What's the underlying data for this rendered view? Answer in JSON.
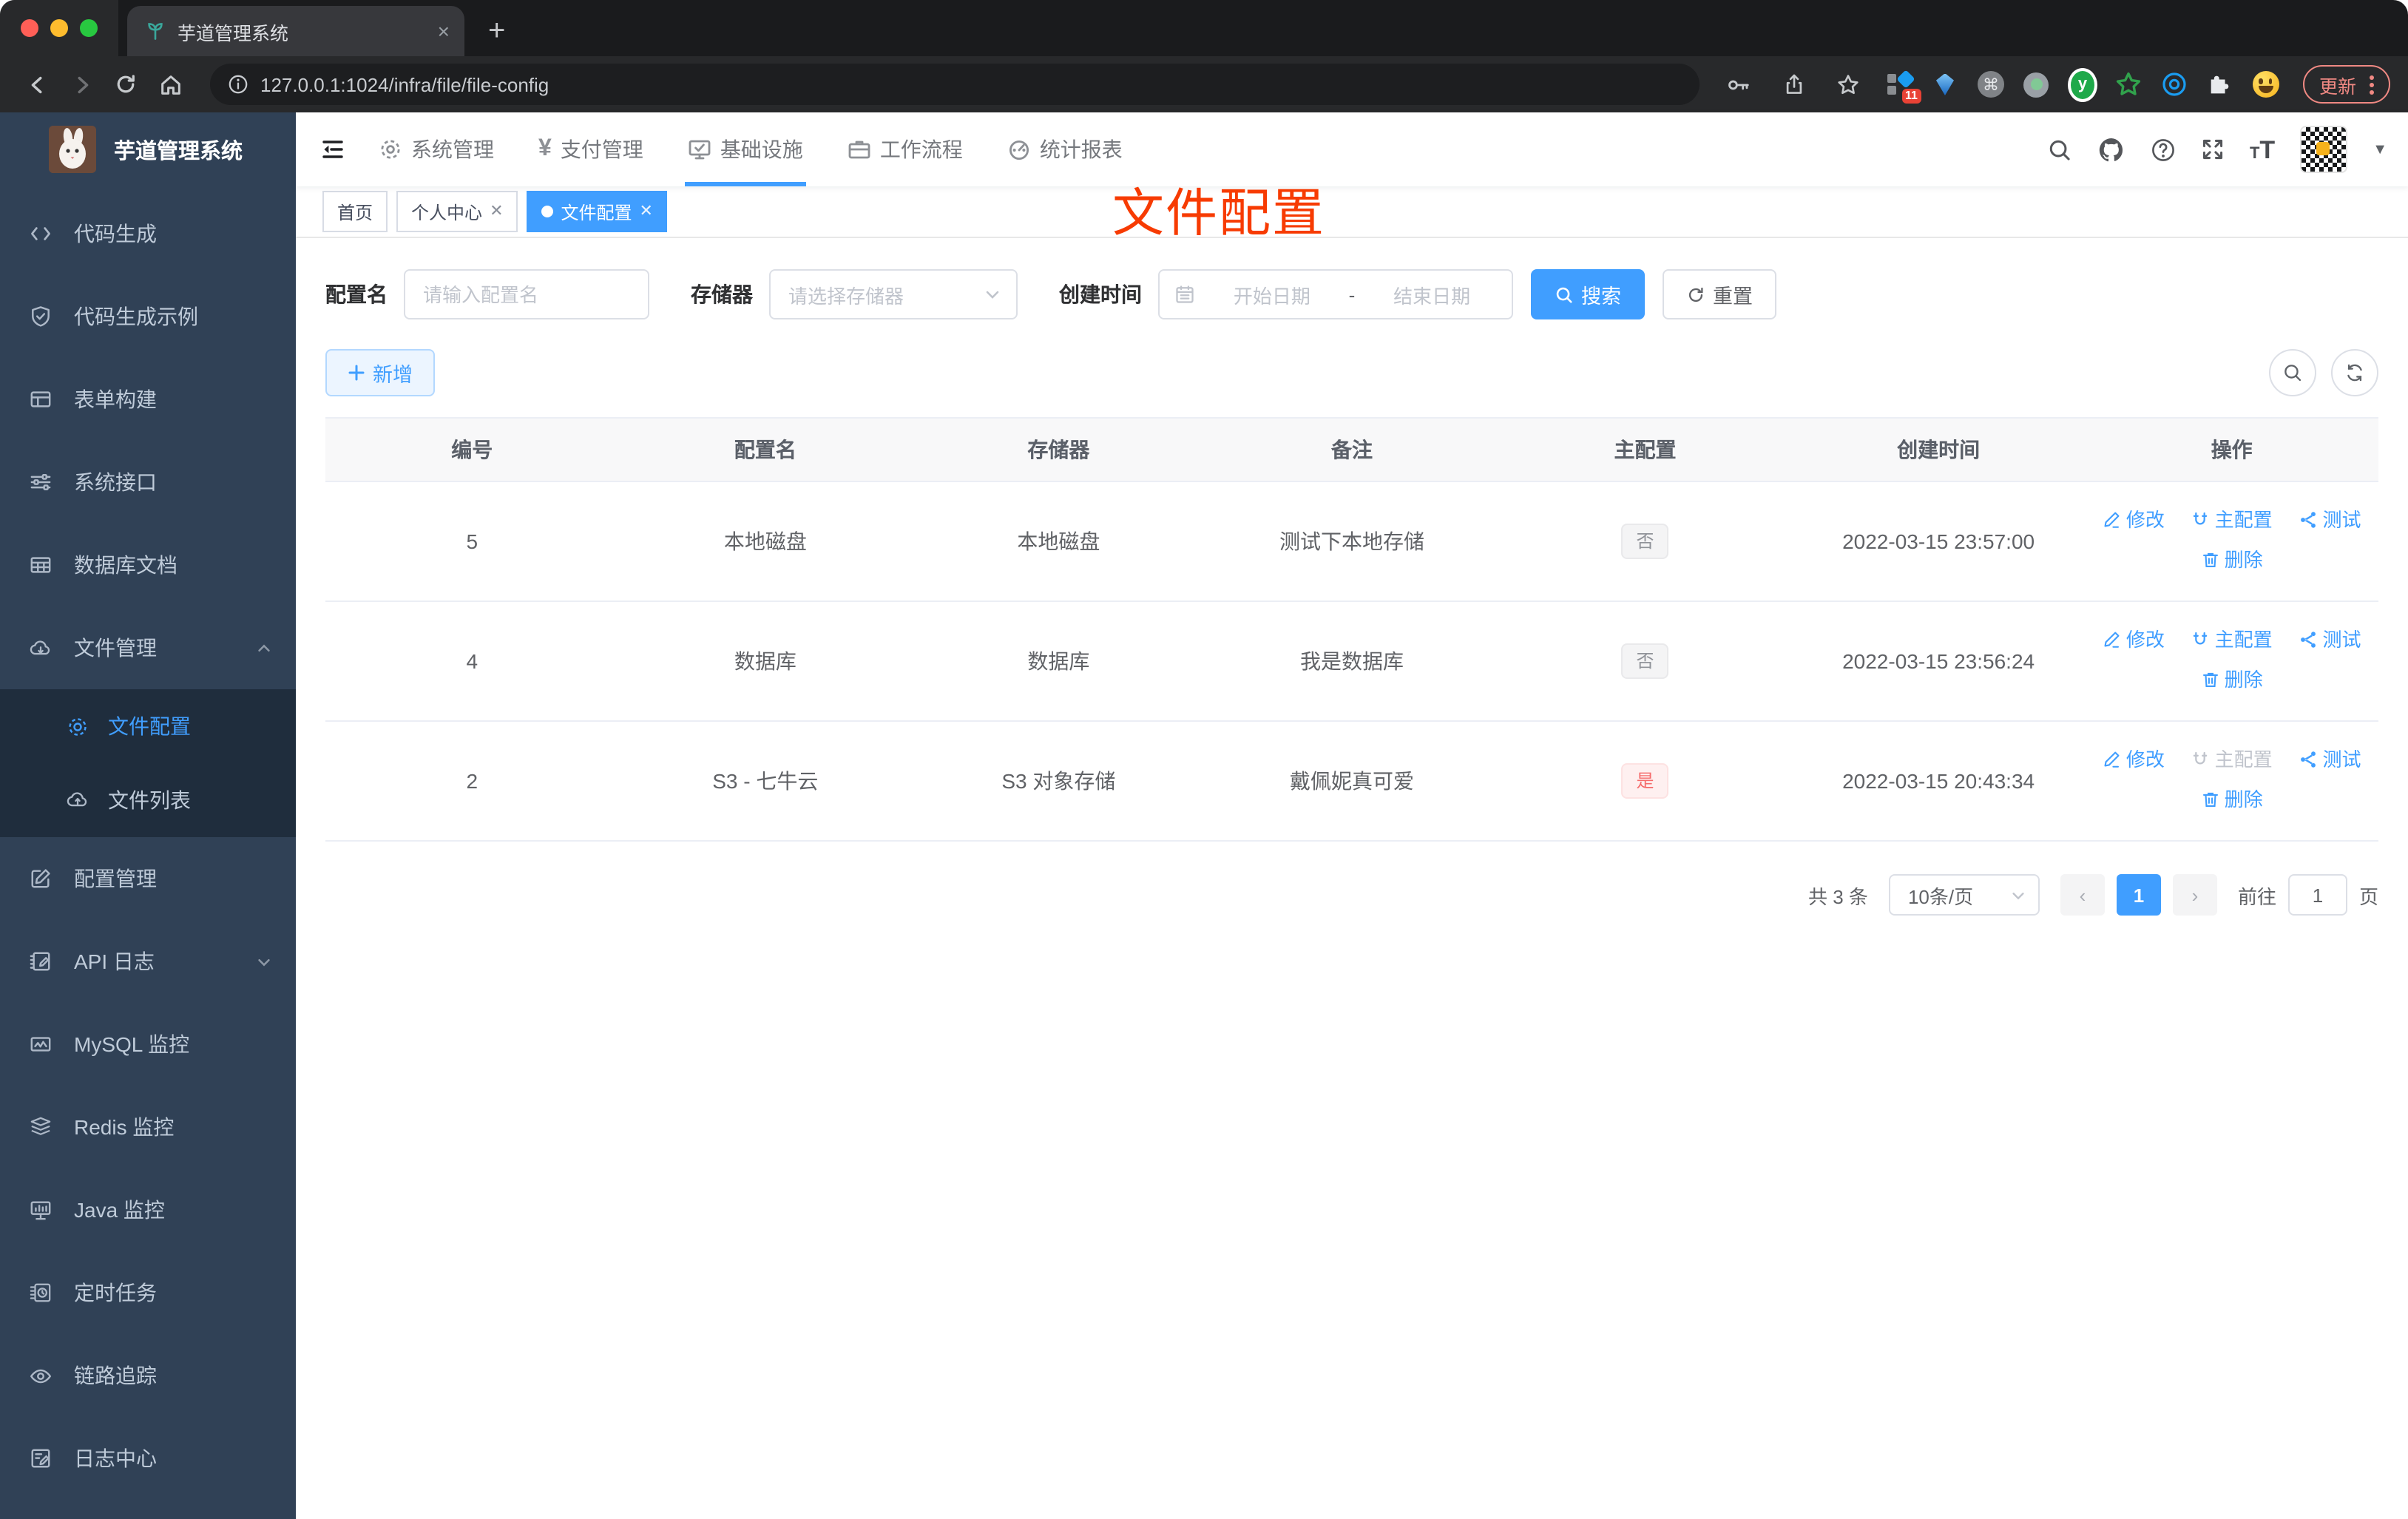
{
  "browser": {
    "tab_title": "芋道管理系统",
    "url": "127.0.0.1:1024/infra/file/file-config",
    "update_label": "更新",
    "extension_badge": "11"
  },
  "sidebar": {
    "app_title": "芋道管理系统",
    "items": [
      {
        "icon": "code-icon",
        "label": "代码生成"
      },
      {
        "icon": "shield-check-icon",
        "label": "代码生成示例"
      },
      {
        "icon": "form-icon",
        "label": "表单构建"
      },
      {
        "icon": "sliders-icon",
        "label": "系统接口"
      },
      {
        "icon": "db-doc-icon",
        "label": "数据库文档"
      },
      {
        "icon": "cloud-download-icon",
        "label": "文件管理",
        "expanded": true,
        "children": [
          {
            "icon": "gear-icon",
            "label": "文件配置",
            "active": true
          },
          {
            "icon": "cloud-upload-icon",
            "label": "文件列表"
          }
        ]
      },
      {
        "icon": "edit-square-icon",
        "label": "配置管理"
      },
      {
        "icon": "log-edit-icon",
        "label": "API 日志",
        "collapsed": true
      },
      {
        "icon": "mysql-monitor-icon",
        "label": "MySQL 监控"
      },
      {
        "icon": "redis-layers-icon",
        "label": "Redis 监控"
      },
      {
        "icon": "java-monitor-icon",
        "label": "Java 监控"
      },
      {
        "icon": "schedule-icon",
        "label": "定时任务"
      },
      {
        "icon": "trace-eye-icon",
        "label": "链路追踪"
      },
      {
        "icon": "log-center-icon",
        "label": "日志中心"
      }
    ]
  },
  "topnav": {
    "items": [
      {
        "icon": "gear-icon",
        "label": "系统管理"
      },
      {
        "icon": "yen-icon",
        "label": "支付管理"
      },
      {
        "icon": "infra-monitor-icon",
        "label": "基础设施",
        "active": true
      },
      {
        "icon": "briefcase-icon",
        "label": "工作流程"
      },
      {
        "icon": "chart-icon",
        "label": "统计报表"
      }
    ]
  },
  "view_tabs": [
    {
      "label": "首页",
      "closable": false,
      "active": false
    },
    {
      "label": "个人中心",
      "closable": true,
      "active": false
    },
    {
      "label": "文件配置",
      "closable": true,
      "active": true
    }
  ],
  "annotation": {
    "text": "文件配置",
    "color": "#f73b02"
  },
  "filters": {
    "config_name_label": "配置名",
    "config_name_placeholder": "请输入配置名",
    "storage_label": "存储器",
    "storage_placeholder": "请选择存储器",
    "create_time_label": "创建时间",
    "date_start_placeholder": "开始日期",
    "date_separator": "-",
    "date_end_placeholder": "结束日期",
    "search_label": "搜索",
    "reset_label": "重置",
    "add_label": "新增"
  },
  "table": {
    "headers": [
      "编号",
      "配置名",
      "存储器",
      "备注",
      "主配置",
      "创建时间",
      "操作"
    ],
    "rows": [
      {
        "id": "5",
        "name": "本地磁盘",
        "storage": "本地磁盘",
        "remark": "测试下本地存储",
        "master": "否",
        "master_type": "info",
        "created": "2022-03-15 23:57:00",
        "master_disabled": false
      },
      {
        "id": "4",
        "name": "数据库",
        "storage": "数据库",
        "remark": "我是数据库",
        "master": "否",
        "master_type": "info",
        "created": "2022-03-15 23:56:24",
        "master_disabled": false
      },
      {
        "id": "2",
        "name": "S3 - 七牛云",
        "storage": "S3 对象存储",
        "remark": "戴佩妮真可爱",
        "master": "是",
        "master_type": "danger",
        "created": "2022-03-15 20:43:34",
        "master_disabled": true
      }
    ],
    "actions": {
      "edit": "修改",
      "master": "主配置",
      "test": "测试",
      "delete": "删除"
    }
  },
  "pagination": {
    "total": "共 3 条",
    "page_size": "10条/页",
    "current_page": "1",
    "goto_label": "前往",
    "goto_value": "1",
    "page_unit": "页"
  },
  "colors": {
    "accent": "#409eff",
    "danger": "#f56c6c",
    "annotation_red": "#f73b02",
    "sidebar_bg": "#304156",
    "submenu_bg": "#1f2d3d"
  }
}
